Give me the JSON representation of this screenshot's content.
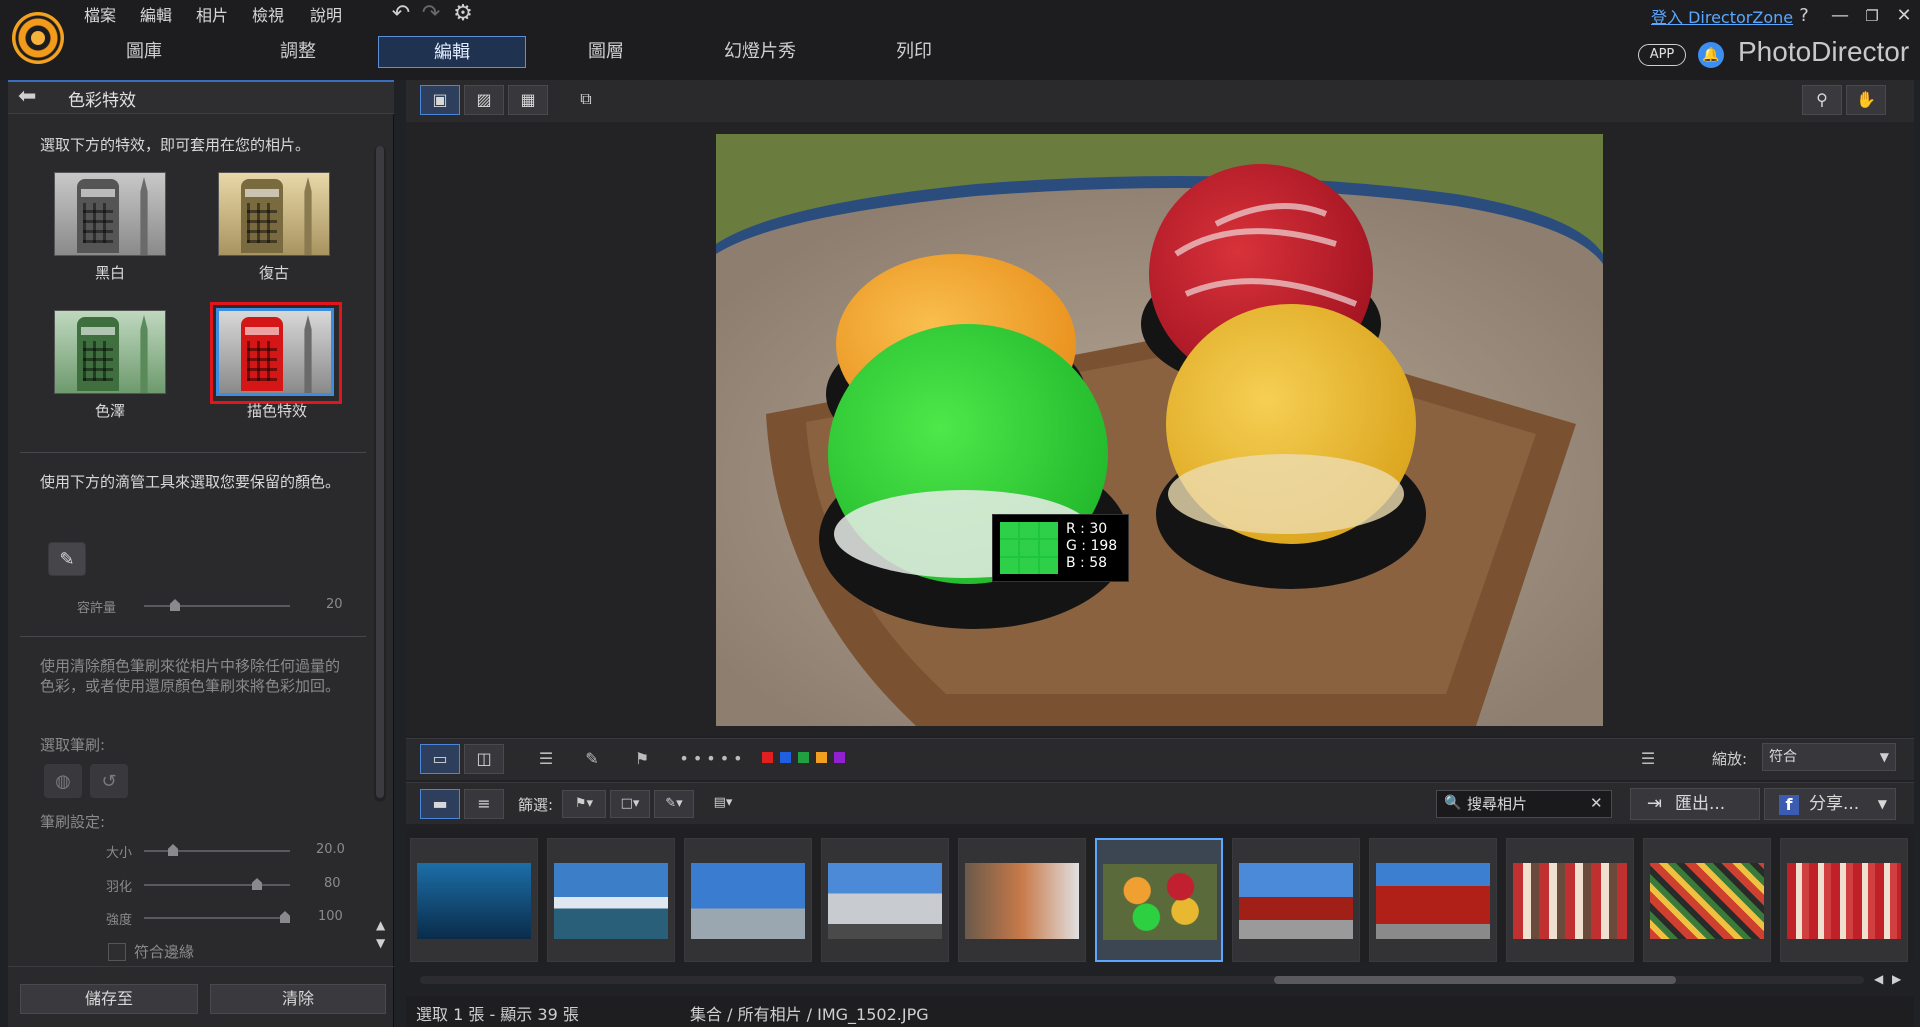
{
  "menu": [
    "檔案",
    "編輯",
    "相片",
    "檢視",
    "說明"
  ],
  "tabs": [
    "圖庫",
    "調整",
    "編輯",
    "圖層",
    "幻燈片秀",
    "列印"
  ],
  "active_tab": "編輯",
  "login_text": "登入 DirectorZone",
  "help_label": "?",
  "app_badge": "APP",
  "brand": "PhotoDirector",
  "panel": {
    "title": "色彩特效",
    "intro": "選取下方的特效，即可套用在您的相片。",
    "effects": [
      {
        "label": "黑白"
      },
      {
        "label": "復古"
      },
      {
        "label": "色澤"
      },
      {
        "label": "描色特效"
      }
    ],
    "selected_effect": "描色特效",
    "dropper_hint": "使用下方的滴管工具來選取您要保留的顏色。",
    "tolerance_label": "容許量",
    "tolerance_value": "20",
    "brush_hint": "使用清除顏色筆刷來從相片中移除任何過量的色彩，或者使用還原顏色筆刷來將色彩加回。",
    "brush_select_label": "選取筆刷:",
    "brush_settings_label": "筆刷設定:",
    "size_label": "大小",
    "size_value": "20.0",
    "feather_label": "羽化",
    "feather_value": "80",
    "strength_label": "強度",
    "strength_value": "100",
    "edge_label": "符合邊緣",
    "save_btn": "儲存至",
    "clear_btn": "清除"
  },
  "rgb": {
    "r": "R : 30",
    "g": "G : 198",
    "b": "B : 58"
  },
  "zoom": {
    "label": "縮放:",
    "value": "符合"
  },
  "filter_label": "篩選:",
  "search_placeholder": "搜尋相片",
  "export_btn": "匯出...",
  "share_btn": "分享...",
  "status": {
    "left": "選取 1 張 - 顯示 39 張",
    "path": "集合 / 所有相片 / IMG_1502.JPG"
  },
  "colors": {
    "accent": "#5ca7ff",
    "selected_border": "#e0161c"
  }
}
